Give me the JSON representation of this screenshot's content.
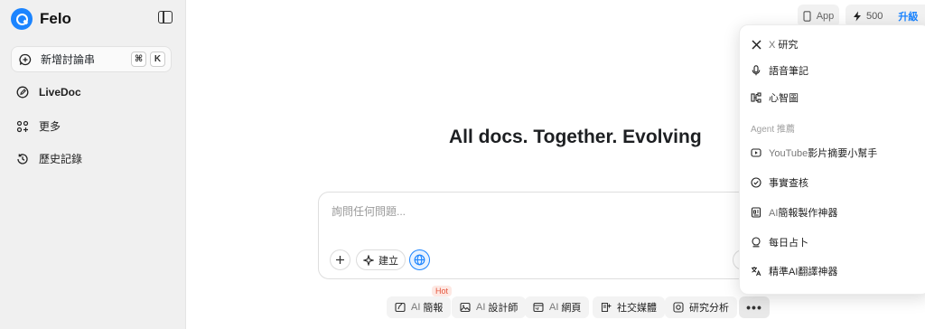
{
  "brand": {
    "name": "Felo",
    "accent": "#1b84ff"
  },
  "sidebar": {
    "new_thread": {
      "label": "新增討論串",
      "keys": [
        "⌘",
        "K"
      ]
    },
    "items": [
      {
        "label": "LiveDoc",
        "icon": "edit-icon"
      },
      {
        "label": "更多",
        "icon": "apps-icon"
      },
      {
        "label": "歷史記錄",
        "icon": "history-icon"
      }
    ]
  },
  "topbar": {
    "app_label": "App",
    "credits": "500",
    "upgrade_label": "升級"
  },
  "main": {
    "headline": "All docs. Together. Evolving",
    "search_placeholder": "詢問任何問題...",
    "create_label": "建立"
  },
  "chips": [
    {
      "ai": "AI",
      "label": "簡報",
      "icon": "slides-icon"
    },
    {
      "ai": "AI",
      "label": "設計師",
      "icon": "image-icon"
    },
    {
      "ai": "AI",
      "label": "網頁",
      "icon": "web-icon"
    },
    {
      "ai": "",
      "label": "社交媒體",
      "icon": "social-icon"
    },
    {
      "ai": "",
      "label": "研究分析",
      "icon": "research-icon"
    }
  ],
  "hot_badge": "Hot",
  "menu": {
    "items_top": [
      {
        "prefix": "X",
        "label": "研究",
        "icon": "x-logo-icon"
      },
      {
        "prefix": "",
        "label": "語音筆記",
        "icon": "mic-icon"
      },
      {
        "prefix": "",
        "label": "心智圖",
        "icon": "mindmap-icon"
      }
    ],
    "section_label": "Agent 推薦",
    "items_agent": [
      {
        "prefix": "YouTube",
        "label": "影片摘要小幫手",
        "icon": "play-icon"
      },
      {
        "prefix": "",
        "label": "事實查核",
        "icon": "check-circle-icon"
      },
      {
        "prefix": "AI",
        "label": "簡報製作神器",
        "icon": "doc-icon"
      },
      {
        "prefix": "",
        "label": "每日占卜",
        "icon": "crystal-icon"
      },
      {
        "prefix": "",
        "label": "精準AI翻譯神器",
        "icon": "translate-icon"
      }
    ]
  }
}
